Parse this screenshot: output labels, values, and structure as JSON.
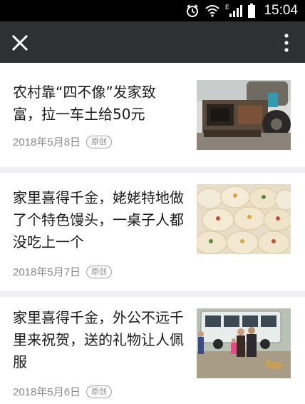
{
  "status_bar": {
    "network_type": "E",
    "time": "15:04"
  },
  "nav": {
    "close_icon": "close-icon",
    "more_icon": "more-vertical-icon"
  },
  "articles": [
    {
      "title": "农村靠“四不像”发家致富，拉一车土给50元",
      "date": "2018年5月8日",
      "badge": "原创",
      "thumbnail": "rusty-vehicle-image"
    },
    {
      "title": "家里喜得千金，姥姥特地做了个特色馒头，一桌子人都没吃上一个",
      "date": "2018年5月7日",
      "badge": "原创",
      "thumbnail": "decorated-buns-image"
    },
    {
      "title": "家里喜得千金，外公不远千里来祝贺，送的礼物让人佩服",
      "date": "2018年5月6日",
      "badge": "原创",
      "thumbnail": "bus-and-people-image"
    }
  ]
}
